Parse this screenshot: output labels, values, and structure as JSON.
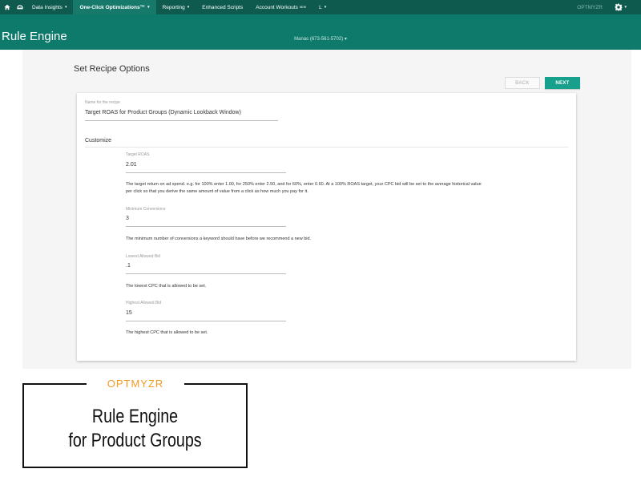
{
  "topnav": {
    "items": [
      {
        "label": "Data Insights",
        "caret": true
      },
      {
        "label": "One-Click Optimizations™",
        "caret": true,
        "active": true
      },
      {
        "label": "Reporting",
        "caret": true
      },
      {
        "label": "Enhanced Scripts",
        "caret": false
      },
      {
        "label": "Account Workouts",
        "badge": "NEW",
        "caret": false
      },
      {
        "label": "L",
        "caret": true
      }
    ],
    "brand": "OPTMYZR",
    "icons": [
      "home-icon",
      "dashboard-icon",
      "gear-icon"
    ]
  },
  "appbar": {
    "title": "Rule Engine",
    "account": "Manas (673-561-5702) ▾"
  },
  "page": {
    "heading": "Set Recipe Options",
    "back_label": "BACK",
    "next_label": "NEXT"
  },
  "form": {
    "recipe_name_label": "Name for the recipe",
    "recipe_name_value": "Target ROAS for Product Groups (Dynamic Lookback Window)",
    "section_title": "Customize",
    "fields": [
      {
        "label": "Target ROAS",
        "value": "2.01",
        "help": "The target return on ad spend. e.g. for 100% enter 1.00, for 250% enter 2.50, and for 60%, enter 0.60. At a 100% ROAS target, your CPC bid will be set to the average historical value",
        "help2": "per click so that you derive the same amount of value from a click as how much you pay for it."
      },
      {
        "label": "Minimum Conversions",
        "value": "3",
        "help": "The minimum number of conversions a keyword should have before we recommend a new bid."
      },
      {
        "label": "Lowest Allowed Bid",
        "value": ".1",
        "help": "The lowest CPC that is allowed to be set."
      },
      {
        "label": "Highest Allowed Bid",
        "value": "15",
        "help": "The highest CPC that is allowed to be set."
      }
    ]
  },
  "promo": {
    "brand": "OPTMYZR",
    "line1": "Rule Engine",
    "line2": "for Product Groups",
    "brand_color": "#f29b24"
  },
  "colors": {
    "nav_bg": "#0e5a4f",
    "appbar_bg": "#0d7a6c",
    "accent": "#17a08c"
  }
}
